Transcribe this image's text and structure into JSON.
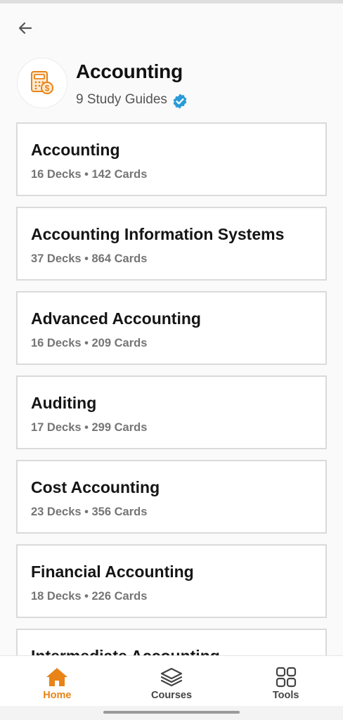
{
  "header": {
    "title": "Accounting",
    "subtitle": "9 Study Guides",
    "logo_icon": "calculator-dollar-icon",
    "verified_icon": "verified-badge-icon"
  },
  "guides": [
    {
      "title": "Accounting",
      "meta": "16 Decks • 142 Cards"
    },
    {
      "title": "Accounting Information Systems",
      "meta": "37 Decks • 864 Cards"
    },
    {
      "title": "Advanced Accounting",
      "meta": "16 Decks • 209 Cards"
    },
    {
      "title": "Auditing",
      "meta": "17 Decks • 299 Cards"
    },
    {
      "title": "Cost Accounting",
      "meta": "23 Decks • 356 Cards"
    },
    {
      "title": "Financial Accounting",
      "meta": "18 Decks • 226 Cards"
    },
    {
      "title": "Intermediate Accounting",
      "meta": ""
    }
  ],
  "bottom_nav": {
    "items": [
      {
        "label": "Home",
        "icon": "home-icon",
        "active": true
      },
      {
        "label": "Courses",
        "icon": "layers-icon",
        "active": false
      },
      {
        "label": "Tools",
        "icon": "grid-icon",
        "active": false
      }
    ]
  },
  "colors": {
    "accent": "#e98317",
    "verified": "#2a9bd8",
    "card_border": "#dadada"
  }
}
